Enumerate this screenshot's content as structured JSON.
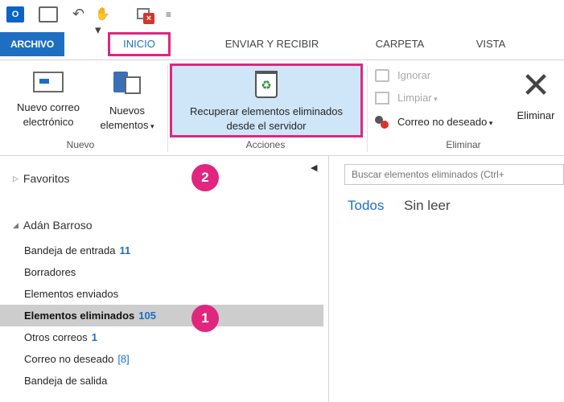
{
  "qat": {
    "app_logo": "O",
    "icons": [
      "outlook-logo",
      "send-receive-icon",
      "undo-icon",
      "touch-mode-icon",
      "empty-folder-icon",
      "customize-icon"
    ]
  },
  "tabs": [
    {
      "label": "ARCHIVO"
    },
    {
      "label": "INICIO",
      "active": true
    },
    {
      "label": "ENVIAR Y RECIBIR"
    },
    {
      "label": "CARPETA"
    },
    {
      "label": "VISTA"
    }
  ],
  "ribbon": {
    "nuevo": {
      "label": "Nuevo",
      "new_email_line1": "Nuevo correo",
      "new_email_line2": "electrónico",
      "new_items_line1": "Nuevos",
      "new_items_line2": "elementos"
    },
    "acciones": {
      "label": "Acciones",
      "recover_line1": "Recuperar elementos eliminados",
      "recover_line2": "desde el servidor"
    },
    "eliminar": {
      "label": "Eliminar",
      "ignore": "Ignorar",
      "clean": "Limpiar",
      "junk": "Correo no deseado",
      "delete": "Eliminar"
    }
  },
  "folder_pane": {
    "favorites": "Favoritos",
    "account": "Adán Barroso",
    "callouts": [
      "2",
      "1"
    ],
    "folders": [
      {
        "name": "Bandeja de entrada",
        "count": "11"
      },
      {
        "name": "Borradores",
        "count": ""
      },
      {
        "name": "Elementos enviados",
        "count": ""
      },
      {
        "name": "Elementos eliminados",
        "count": "105",
        "selected": true
      },
      {
        "name": "Otros correos",
        "count": "1"
      },
      {
        "name": "Correo no deseado",
        "count": "[8]"
      },
      {
        "name": "Bandeja de salida",
        "count": ""
      }
    ]
  },
  "message_list": {
    "search_placeholder": "Buscar elementos eliminados (Ctrl+",
    "filters": [
      "Todos",
      "Sin leer"
    ]
  },
  "colors": {
    "accent": "#1e6ec2",
    "highlight": "#e0267f",
    "selected_button": "#cfe5f8",
    "selected_folder": "#cdcdcd"
  }
}
